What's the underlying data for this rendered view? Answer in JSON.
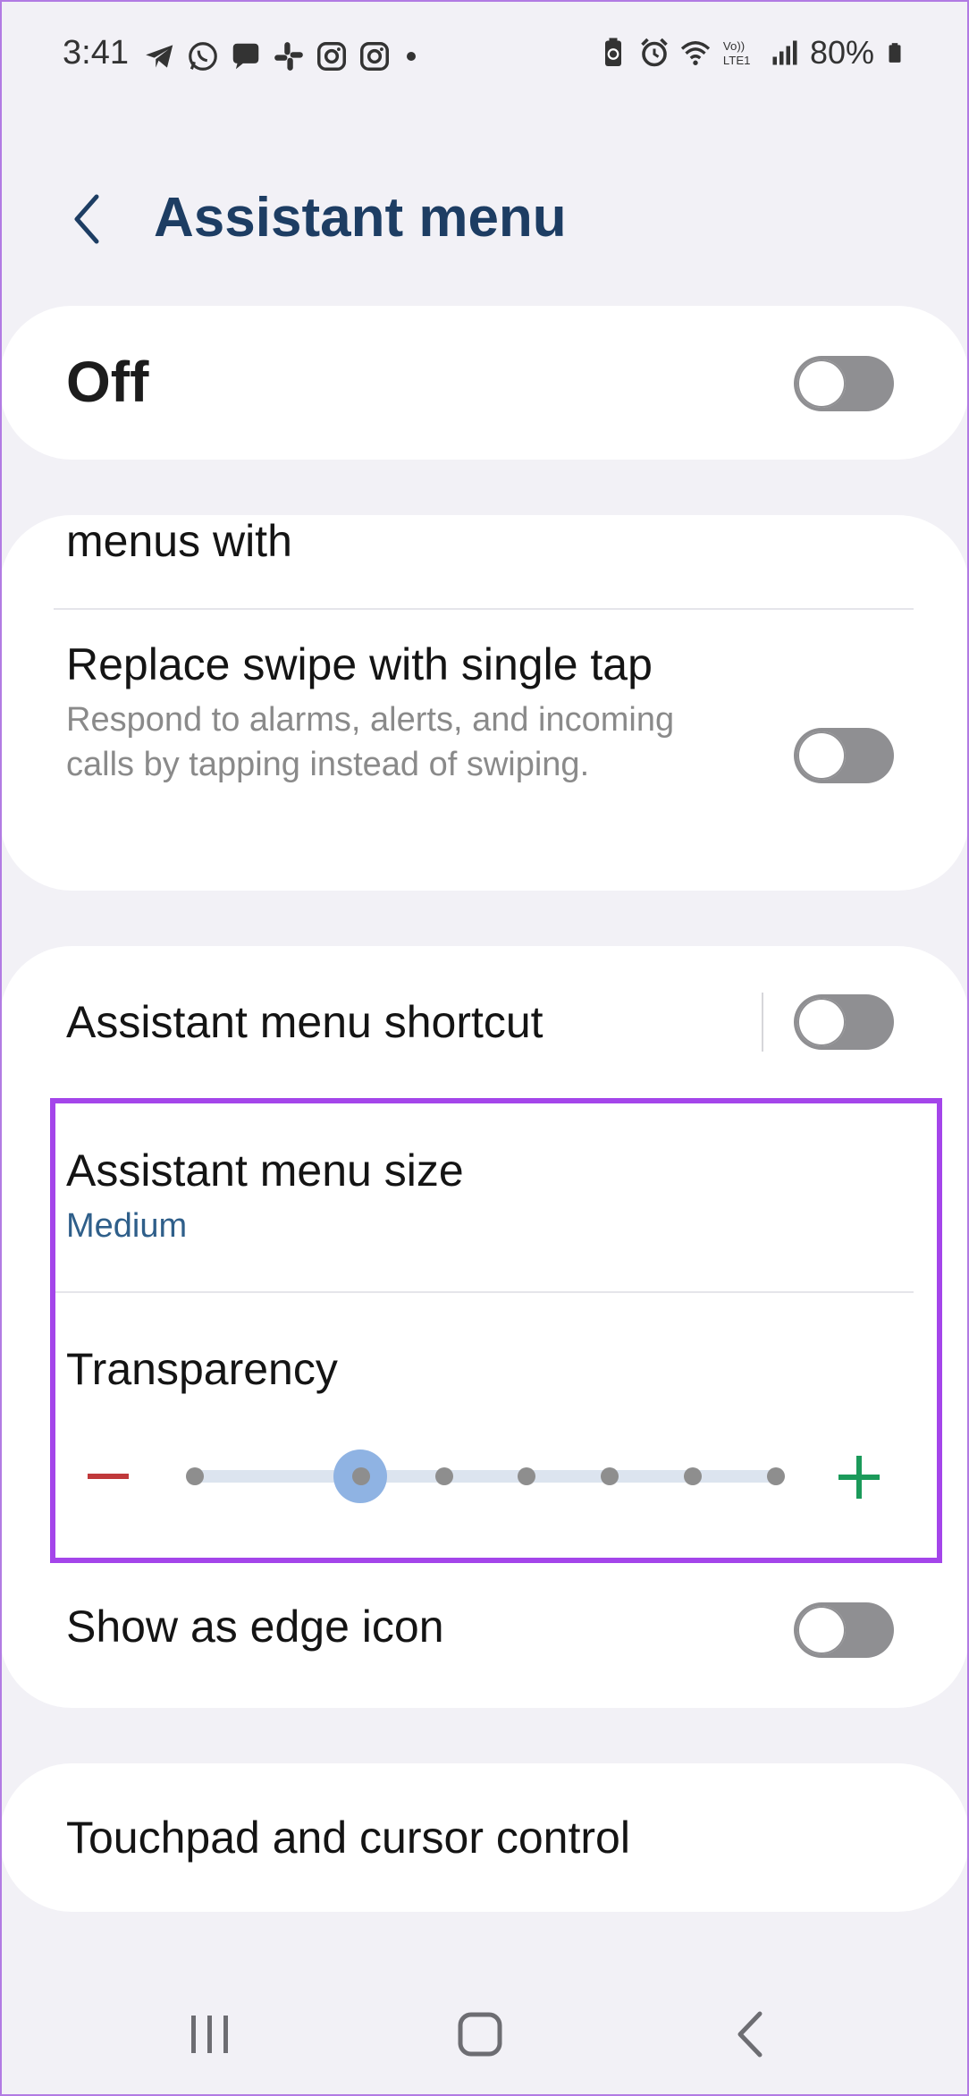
{
  "status_bar": {
    "time": "3:41",
    "battery": "80%",
    "notification_icons": [
      "telegram-icon",
      "whatsapp-icon",
      "chat-icon",
      "slack-icon",
      "instagram-icon",
      "instagram-icon",
      "dot-icon"
    ],
    "system_icons": [
      "battery-saver-icon",
      "alarm-icon",
      "wifi-icon",
      "volte-icon",
      "signal-icon",
      "battery-icon"
    ],
    "volte_label": "Vo))\nLTE1"
  },
  "header": {
    "title": "Assistant menu"
  },
  "master_toggle": {
    "label": "Off",
    "state": false
  },
  "card_one": {
    "partial_label": "menus with",
    "replace_swipe": {
      "title": "Replace swipe with single tap",
      "subtitle": "Respond to alarms, alerts, and incoming calls by tapping instead of swiping.",
      "state": false
    }
  },
  "card_two": {
    "shortcut": {
      "title": "Assistant menu shortcut",
      "state": false
    },
    "size": {
      "title": "Assistant menu size",
      "value": "Medium"
    },
    "transparency": {
      "title": "Transparency",
      "steps": 8,
      "selected_index": 1
    },
    "edge_icon": {
      "title": "Show as edge icon",
      "state": false
    }
  },
  "card_three": {
    "title": "Touchpad and cursor control"
  },
  "colors": {
    "title": "#1d3d63",
    "accent_value": "#2f5f8a",
    "highlight": "#a445ea",
    "minus": "#c0393b",
    "plus": "#1b9a5a",
    "slider_thumb": "#8fb3e3"
  },
  "nav_bar": [
    "recents-icon",
    "home-icon",
    "back-icon"
  ]
}
